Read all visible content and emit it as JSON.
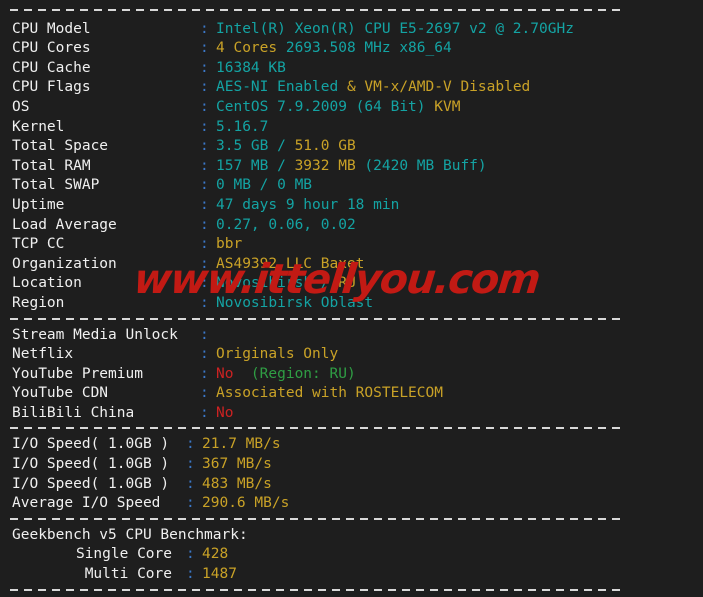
{
  "watermark": "www.ittellyou.com",
  "colors": {
    "background": "#1e1e1e",
    "label": "#f0f0f0",
    "colon": "#3b78c8",
    "cyan": "#14a3a3",
    "yellow": "#c9a227",
    "red": "#cc2222",
    "green": "#2f9e44",
    "separator": "#d8d8d8"
  },
  "system_info": {
    "cpu_model": {
      "label": "CPU Model",
      "value": "Intel(R) Xeon(R) CPU E5-2697 v2 @ 2.70GHz"
    },
    "cpu_cores": {
      "label": "CPU Cores",
      "value_highlight": "4 Cores",
      "value_rest": "2693.508 MHz x86_64"
    },
    "cpu_cache": {
      "label": "CPU Cache",
      "value": "16384 KB"
    },
    "cpu_flags": {
      "label": "CPU Flags",
      "value_a": "AES-NI Enabled ",
      "value_b": "& ",
      "value_c": "VM-x/AMD-V Disabled"
    },
    "os": {
      "label": "OS",
      "value_a": "CentOS 7.9.2009 (64 Bit) ",
      "value_b": "KVM"
    },
    "kernel": {
      "label": "Kernel",
      "value": "5.16.7"
    },
    "total_space": {
      "label": "Total Space",
      "value_a": "3.5 GB / ",
      "value_b": "51.0 GB"
    },
    "total_ram": {
      "label": "Total RAM",
      "value_a": "157 MB / ",
      "value_b": "3932 MB",
      "value_c": " (2420 MB Buff)"
    },
    "total_swap": {
      "label": "Total SWAP",
      "value": "0 MB / 0 MB"
    },
    "uptime": {
      "label": "Uptime",
      "value": "47 days 9 hour 18 min"
    },
    "load_average": {
      "label": "Load Average",
      "value": "0.27, 0.06, 0.02"
    },
    "tcp_cc": {
      "label": "TCP CC",
      "value": "bbr"
    },
    "organization": {
      "label": "Organization",
      "value": "AS49392 LLC Baxet"
    },
    "location": {
      "label": "Location",
      "value_a": "Novosibirsk / ",
      "value_b": "RU"
    },
    "region": {
      "label": "Region",
      "value": "Novosibirsk Oblast"
    }
  },
  "stream_media": {
    "heading": {
      "label": "Stream Media Unlock",
      "value": ""
    },
    "netflix": {
      "label": "Netflix",
      "value": "Originals Only"
    },
    "youtube_premium": {
      "label": "YouTube Premium",
      "value_a": "No",
      "value_b": "  (Region: RU)"
    },
    "youtube_cdn": {
      "label": "YouTube CDN",
      "value": "Associated with ROSTELECOM"
    },
    "bilibili_china": {
      "label": "BiliBili China",
      "value": "No"
    }
  },
  "io_speed": {
    "test1": {
      "label": "I/O Speed( 1.0GB )",
      "value": "21.7 MB/s"
    },
    "test2": {
      "label": "I/O Speed( 1.0GB )",
      "value": "367 MB/s"
    },
    "test3": {
      "label": "I/O Speed( 1.0GB )",
      "value": "483 MB/s"
    },
    "average": {
      "label": "Average I/O Speed",
      "value": "290.6 MB/s"
    }
  },
  "geekbench": {
    "title": "Geekbench v5 CPU Benchmark:",
    "single_core": {
      "label": "Single Core",
      "value": "428"
    },
    "multi_core": {
      "label": "Multi Core",
      "value": "1487"
    }
  }
}
